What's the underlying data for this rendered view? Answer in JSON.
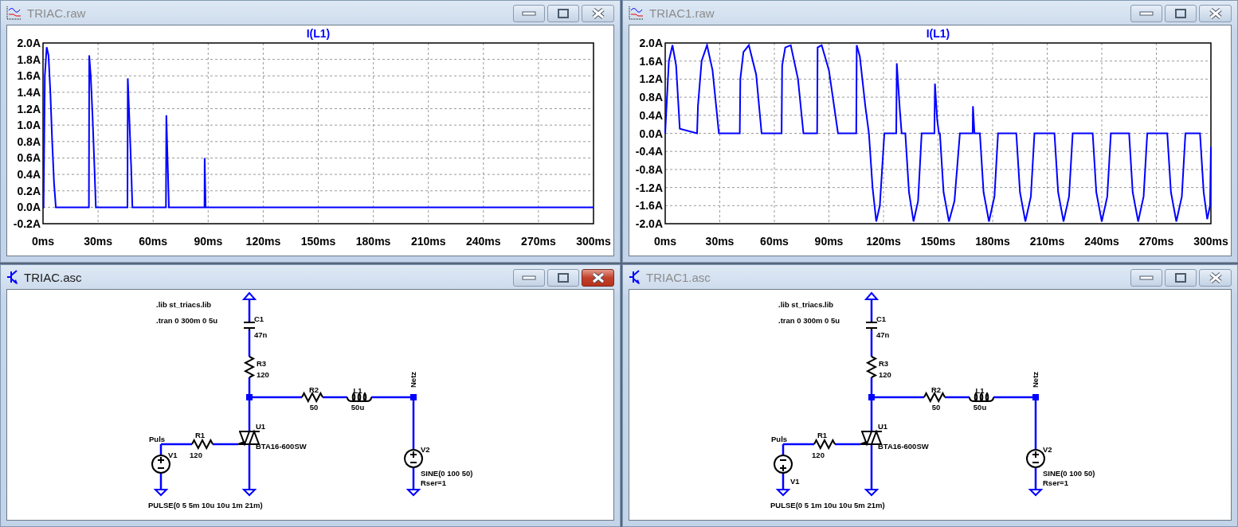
{
  "windows": [
    {
      "kind": "waveform",
      "title": "TRIAC.raw",
      "active": false,
      "chart_data": {
        "type": "line",
        "grid": true,
        "xlim": [
          0,
          300
        ],
        "ylim": [
          -0.2,
          2.0
        ],
        "xticks": [
          {
            "value": 0,
            "label": "0ms"
          },
          {
            "value": 30,
            "label": "30ms"
          },
          {
            "value": 60,
            "label": "60ms"
          },
          {
            "value": 90,
            "label": "90ms"
          },
          {
            "value": 120,
            "label": "120ms"
          },
          {
            "value": 150,
            "label": "150ms"
          },
          {
            "value": 180,
            "label": "180ms"
          },
          {
            "value": 210,
            "label": "210ms"
          },
          {
            "value": 240,
            "label": "240ms"
          },
          {
            "value": 270,
            "label": "270ms"
          },
          {
            "value": 300,
            "label": "300ms"
          }
        ],
        "yticks": [
          {
            "value": 2.0,
            "label": "2.0A"
          },
          {
            "value": 1.8,
            "label": "1.8A"
          },
          {
            "value": 1.6,
            "label": "1.6A"
          },
          {
            "value": 1.4,
            "label": "1.4A"
          },
          {
            "value": 1.2,
            "label": "1.2A"
          },
          {
            "value": 1.0,
            "label": "1.0A"
          },
          {
            "value": 0.8,
            "label": "0.8A"
          },
          {
            "value": 0.6,
            "label": "0.6A"
          },
          {
            "value": 0.4,
            "label": "0.4A"
          },
          {
            "value": 0.2,
            "label": "0.2A"
          },
          {
            "value": 0.0,
            "label": "0.0A"
          },
          {
            "value": -0.2,
            "label": "-0.2A"
          }
        ],
        "x": [
          0,
          0.3,
          1,
          2,
          3,
          4,
          5,
          6,
          7,
          25,
          25.2,
          26,
          27,
          28,
          28.8,
          46,
          46.2,
          47,
          48,
          48.7,
          67,
          67.2,
          68,
          68.6,
          88,
          88.1,
          88.6,
          300
        ],
        "series": [
          {
            "name": "I(L1)",
            "color": "#0000ff",
            "values": [
              0,
              0,
              1.6,
              1.95,
              1.85,
              1.4,
              0.8,
              0.3,
              0,
              0,
              1.85,
              1.6,
              1.1,
              0.5,
              0,
              0,
              1.57,
              1.1,
              0.5,
              0,
              0,
              1.12,
              0.5,
              0,
              0,
              0.6,
              0,
              0
            ]
          }
        ]
      }
    },
    {
      "kind": "waveform",
      "title": "TRIAC1.raw",
      "active": false,
      "chart_data": {
        "type": "line",
        "grid": true,
        "xlim": [
          0,
          300
        ],
        "ylim": [
          -2.0,
          2.0
        ],
        "xticks": [
          {
            "value": 0,
            "label": "0ms"
          },
          {
            "value": 30,
            "label": "30ms"
          },
          {
            "value": 60,
            "label": "60ms"
          },
          {
            "value": 90,
            "label": "90ms"
          },
          {
            "value": 120,
            "label": "120ms"
          },
          {
            "value": 150,
            "label": "150ms"
          },
          {
            "value": 180,
            "label": "180ms"
          },
          {
            "value": 210,
            "label": "210ms"
          },
          {
            "value": 240,
            "label": "240ms"
          },
          {
            "value": 270,
            "label": "270ms"
          },
          {
            "value": 300,
            "label": "300ms"
          }
        ],
        "yticks": [
          {
            "value": 2.0,
            "label": "2.0A"
          },
          {
            "value": 1.6,
            "label": "1.6A"
          },
          {
            "value": 1.2,
            "label": "1.2A"
          },
          {
            "value": 0.8,
            "label": "0.8A"
          },
          {
            "value": 0.4,
            "label": "0.4A"
          },
          {
            "value": 0.0,
            "label": "0.0A"
          },
          {
            "value": -0.4,
            "label": "-0.4A"
          },
          {
            "value": -0.8,
            "label": "-0.8A"
          },
          {
            "value": -1.2,
            "label": "-1.2A"
          },
          {
            "value": -1.6,
            "label": "-1.6A"
          },
          {
            "value": -2.0,
            "label": "-2.0A"
          }
        ],
        "x": [
          0,
          0.5,
          2,
          4,
          6,
          8,
          17.5,
          18,
          20,
          23,
          26,
          29.5,
          41,
          41.3,
          43,
          46,
          50,
          53,
          64,
          64.3,
          66,
          69,
          73,
          76,
          83.5,
          83.8,
          86,
          90,
          95,
          105,
          105.3,
          107,
          110,
          112,
          114,
          116,
          118,
          120.5,
          127,
          127.3,
          129,
          130,
          132,
          134,
          136.5,
          139,
          141,
          148,
          148.3,
          149.5,
          150.5,
          151,
          153,
          156,
          159,
          162,
          169,
          169.2,
          170,
          173,
          175,
          178,
          181,
          183,
          193,
          195,
          198,
          201,
          203,
          214,
          216,
          219,
          222,
          224,
          235,
          237,
          240,
          243,
          245,
          255,
          257,
          260,
          263,
          265,
          276,
          278,
          281,
          284,
          286,
          294,
          296,
          298,
          299.5,
          300
        ],
        "series": [
          {
            "name": "I(L1)",
            "color": "#0000ff",
            "values": [
              0,
              0.4,
              1.6,
              1.95,
              1.5,
              0.1,
              0,
              0.6,
              1.6,
              1.95,
              1.4,
              0,
              0,
              1.2,
              1.8,
              1.95,
              1.3,
              0,
              0,
              1.5,
              1.9,
              1.95,
              1.2,
              0,
              0,
              1.9,
              1.95,
              1.4,
              0,
              0,
              1.95,
              1.7,
              0.6,
              0,
              -1.2,
              -1.95,
              -1.6,
              0,
              0,
              1.55,
              0.5,
              0,
              0,
              -1.3,
              -1.95,
              -1.5,
              0,
              0,
              1.1,
              0.3,
              0,
              0,
              -1.3,
              -1.95,
              -1.5,
              0,
              0,
              0.6,
              0,
              0,
              -1.3,
              -1.95,
              -1.4,
              0,
              0,
              -1.3,
              -1.95,
              -1.4,
              0,
              0,
              -1.3,
              -1.95,
              -1.4,
              0,
              0,
              -1.3,
              -1.95,
              -1.4,
              0,
              0,
              -1.3,
              -1.95,
              -1.4,
              0,
              0,
              -1.3,
              -1.95,
              -1.4,
              0,
              0,
              -1.3,
              -1.9,
              -1.6,
              -0.3
            ]
          }
        ]
      }
    },
    {
      "kind": "schematic",
      "title": "TRIAC.asc",
      "active": true,
      "schematic": {
        "directives": [
          ".lib st_triacs.lib",
          ".tran 0 300m 0 5u"
        ],
        "net_labels": [
          "Puls",
          "Netz"
        ],
        "components": [
          {
            "kind": "capacitor",
            "ref": "C1",
            "values": [
              "47n"
            ]
          },
          {
            "kind": "resistor",
            "ref": "R3",
            "values": [
              "120"
            ]
          },
          {
            "kind": "resistor",
            "ref": "R2",
            "values": [
              "50"
            ]
          },
          {
            "kind": "inductor",
            "ref": "L1",
            "values": [
              "50u"
            ]
          },
          {
            "kind": "triac",
            "ref": "U1",
            "values": [
              "BTA16-600SW"
            ]
          },
          {
            "kind": "resistor",
            "ref": "R1",
            "values": [
              "120"
            ]
          },
          {
            "kind": "voltage_source",
            "ref": "V1",
            "inverted": false,
            "values": [
              "PULSE(0 5 5m 10u 10u 1m 21m)"
            ]
          },
          {
            "kind": "voltage_source",
            "ref": "V2",
            "inverted": false,
            "values": [
              "SINE(0 100 50)",
              "Rser=1"
            ]
          }
        ]
      }
    },
    {
      "kind": "schematic",
      "title": "TRIAC1.asc",
      "active": false,
      "schematic": {
        "directives": [
          ".lib st_triacs.lib",
          ".tran 0 300m 0 5u"
        ],
        "net_labels": [
          "Puls",
          "Netz"
        ],
        "components": [
          {
            "kind": "capacitor",
            "ref": "C1",
            "values": [
              "47n"
            ]
          },
          {
            "kind": "resistor",
            "ref": "R3",
            "values": [
              "120"
            ]
          },
          {
            "kind": "resistor",
            "ref": "R2",
            "values": [
              "50"
            ]
          },
          {
            "kind": "inductor",
            "ref": "L1",
            "values": [
              "50u"
            ]
          },
          {
            "kind": "triac",
            "ref": "U1",
            "values": [
              "BTA16-600SW"
            ]
          },
          {
            "kind": "resistor",
            "ref": "R1",
            "values": [
              "120"
            ]
          },
          {
            "kind": "voltage_source",
            "ref": "V1",
            "inverted": true,
            "values": [
              "PULSE(0 5 1m 10u 10u 5m 21m)"
            ]
          },
          {
            "kind": "voltage_source",
            "ref": "V2",
            "inverted": false,
            "values": [
              "SINE(0 100 50)",
              "Rser=1"
            ]
          }
        ]
      }
    }
  ]
}
